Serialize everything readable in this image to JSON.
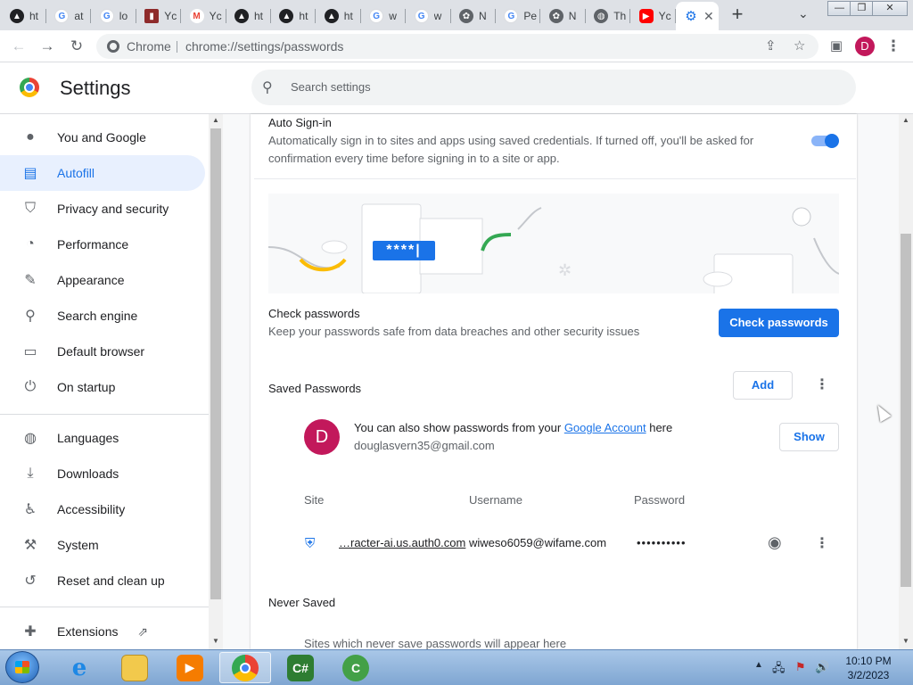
{
  "browser": {
    "tabs": [
      {
        "title": "ht",
        "icon": "notion-icon"
      },
      {
        "title": "at",
        "icon": "google-icon"
      },
      {
        "title": "lo",
        "icon": "google-icon"
      },
      {
        "title": "Yc",
        "icon": "bookmark-icon"
      },
      {
        "title": "Yc",
        "icon": "gmail-icon"
      },
      {
        "title": "ht",
        "icon": "notion-icon"
      },
      {
        "title": "ht",
        "icon": "notion-icon"
      },
      {
        "title": "ht",
        "icon": "notion-icon"
      },
      {
        "title": "w",
        "icon": "google-icon"
      },
      {
        "title": "w",
        "icon": "google-icon"
      },
      {
        "title": "N",
        "icon": "chatgpt-icon"
      },
      {
        "title": "Pe",
        "icon": "google-icon"
      },
      {
        "title": "N",
        "icon": "chatgpt-icon"
      },
      {
        "title": "Th",
        "icon": "globe-icon"
      },
      {
        "title": "Yc",
        "icon": "youtube-icon"
      }
    ],
    "active_tab_icon": "gear-icon",
    "omnibox_chip": "Chrome",
    "url": "chrome://settings/passwords",
    "profile_initial": "D"
  },
  "settings": {
    "title": "Settings",
    "search_placeholder": "Search settings",
    "nav": [
      {
        "label": "You and Google",
        "icon": "person-icon"
      },
      {
        "label": "Autofill",
        "icon": "autofill-icon",
        "active": true
      },
      {
        "label": "Privacy and security",
        "icon": "shield-icon"
      },
      {
        "label": "Performance",
        "icon": "gauge-icon"
      },
      {
        "label": "Appearance",
        "icon": "palette-icon"
      },
      {
        "label": "Search engine",
        "icon": "search-icon"
      },
      {
        "label": "Default browser",
        "icon": "browser-icon"
      },
      {
        "label": "On startup",
        "icon": "power-icon"
      },
      {
        "label": "Languages",
        "icon": "globe-icon"
      },
      {
        "label": "Downloads",
        "icon": "download-icon"
      },
      {
        "label": "Accessibility",
        "icon": "accessibility-icon"
      },
      {
        "label": "System",
        "icon": "wrench-icon"
      },
      {
        "label": "Reset and clean up",
        "icon": "history-icon"
      },
      {
        "label": "Extensions",
        "icon": "puzzle-icon"
      }
    ]
  },
  "autosignin": {
    "title": "Auto Sign-in",
    "desc_line1": "Automatically sign in to sites and apps using saved credentials. If turned off, you'll be asked for",
    "desc_line2": "confirmation every time before signing in to a site or app.",
    "enabled": true
  },
  "illustration": {
    "badge": "****|"
  },
  "check": {
    "title": "Check passwords",
    "desc": "Keep your passwords safe from data breaches and other security issues",
    "button": "Check passwords"
  },
  "saved": {
    "title": "Saved Passwords",
    "add_button": "Add",
    "account_initial": "D",
    "account_text_before": "You can also show passwords from your ",
    "account_link": "Google Account",
    "account_text_after": " here",
    "account_email": "douglasvern35@gmail.com",
    "show_button": "Show",
    "columns": {
      "site": "Site",
      "username": "Username",
      "password": "Password"
    },
    "rows": [
      {
        "site": "…racter-ai.us.auth0.com",
        "username": "wiweso6059@wifame.com",
        "password": "••••••••••"
      }
    ]
  },
  "never_saved": {
    "title": "Never Saved",
    "desc": "Sites which never save passwords will appear here"
  },
  "taskbar": {
    "time": "10:10 PM",
    "date": "3/2/2023",
    "apps": [
      "ie-icon",
      "explorer-icon",
      "media-player-icon",
      "chrome-icon",
      "csharp-icon",
      "ccleaner-icon"
    ]
  }
}
